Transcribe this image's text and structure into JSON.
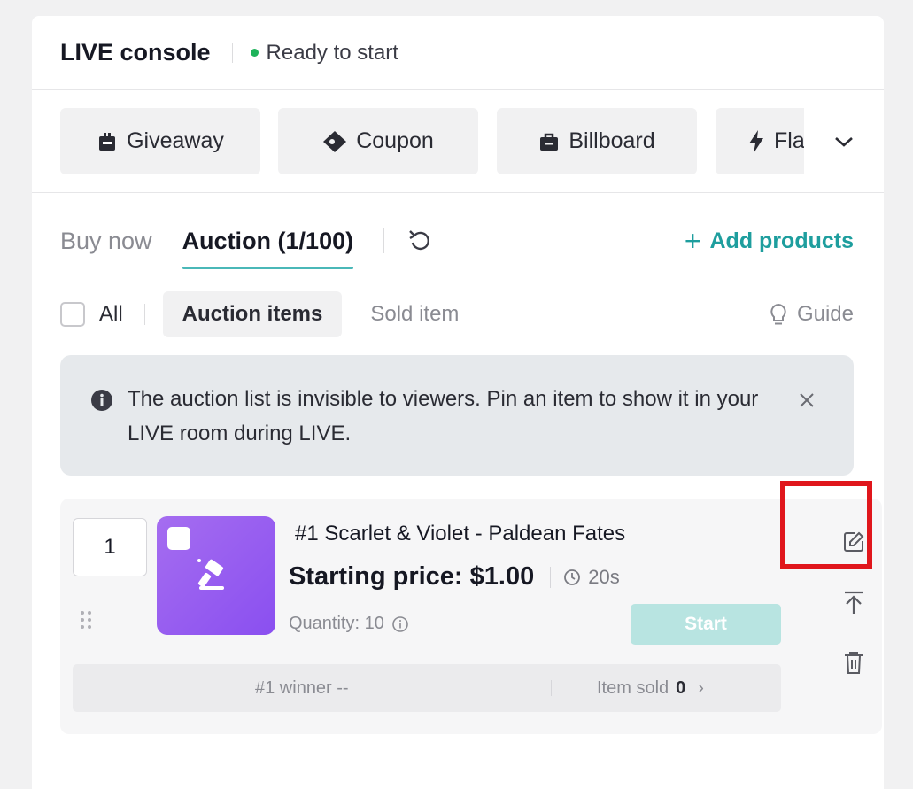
{
  "header": {
    "title": "LIVE console",
    "status": "Ready to start",
    "status_color": "#1eb35a"
  },
  "tools": [
    {
      "label": "Giveaway",
      "icon": "gift-icon"
    },
    {
      "label": "Coupon",
      "icon": "coupon-ticket-icon"
    },
    {
      "label": "Billboard",
      "icon": "billboard-bag-icon"
    },
    {
      "label": "Fla",
      "icon": "flash-lightning-icon"
    }
  ],
  "tabs": {
    "buy_now": "Buy now",
    "auction": "Auction (1/100)",
    "add_products": "Add products"
  },
  "filters": {
    "all": "All",
    "auction_items": "Auction items",
    "sold_item": "Sold item",
    "guide": "Guide"
  },
  "notice": {
    "text": "The auction list is invisible to viewers. Pin an item to show it in your LIVE room during LIVE."
  },
  "item": {
    "order": "1",
    "title": "#1 Scarlet & Violet - Paldean Fates",
    "price": "Starting price: $1.00",
    "timer": "20s",
    "quantity": "Quantity: 10",
    "start": "Start",
    "winner": "#1 winner --",
    "sold_label": "Item sold",
    "sold_count": "0"
  },
  "colors": {
    "accent": "#1e9e9e",
    "tab_underline": "#4ab8b8",
    "thumbnail": "#9b5ff0",
    "start_button": "#b8e4e1",
    "highlight": "#e0161c"
  }
}
